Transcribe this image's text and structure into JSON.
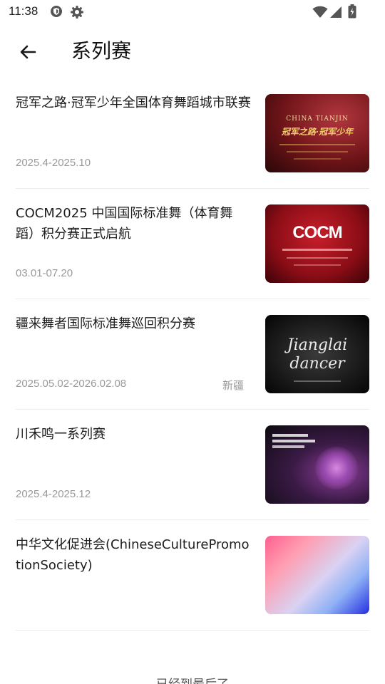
{
  "status_bar": {
    "time": "11:38",
    "icons": [
      "shield-icon",
      "settings-gear-icon",
      "wifi-icon",
      "signal-icon",
      "battery-icon"
    ]
  },
  "header": {
    "title": "系列赛",
    "back_icon": "arrow-left-icon"
  },
  "series": [
    {
      "title": "冠军之路·冠军少年全国体育舞蹈城市联赛",
      "date": "2025.4-2025.10",
      "region": "",
      "thumb_texts": [
        "CHINA TIANJIN",
        "冠军之路·冠军少年"
      ]
    },
    {
      "title": "COCM2025 中国国际标准舞（体育舞蹈）积分赛正式启航",
      "date": "03.01-07.20",
      "region": "",
      "thumb_texts": [
        "COCM"
      ]
    },
    {
      "title": "疆来舞者国际标准舞巡回积分赛",
      "date": "2025.05.02-2026.02.08",
      "region": "新疆",
      "thumb_texts": [
        "Jianglai",
        "dancer"
      ]
    },
    {
      "title": "川禾鸣一系列赛",
      "date": "2025.4-2025.12",
      "region": "",
      "thumb_texts": []
    },
    {
      "title": "中华文化促进会(ChineseCulturePromotionSociety)",
      "date": "",
      "region": "",
      "thumb_texts": []
    }
  ],
  "footer": {
    "end_text": "已经到最后了"
  },
  "colors": {
    "text_primary": "#1d1d1d",
    "text_secondary": "#9a9a9a",
    "divider": "#ececec"
  }
}
